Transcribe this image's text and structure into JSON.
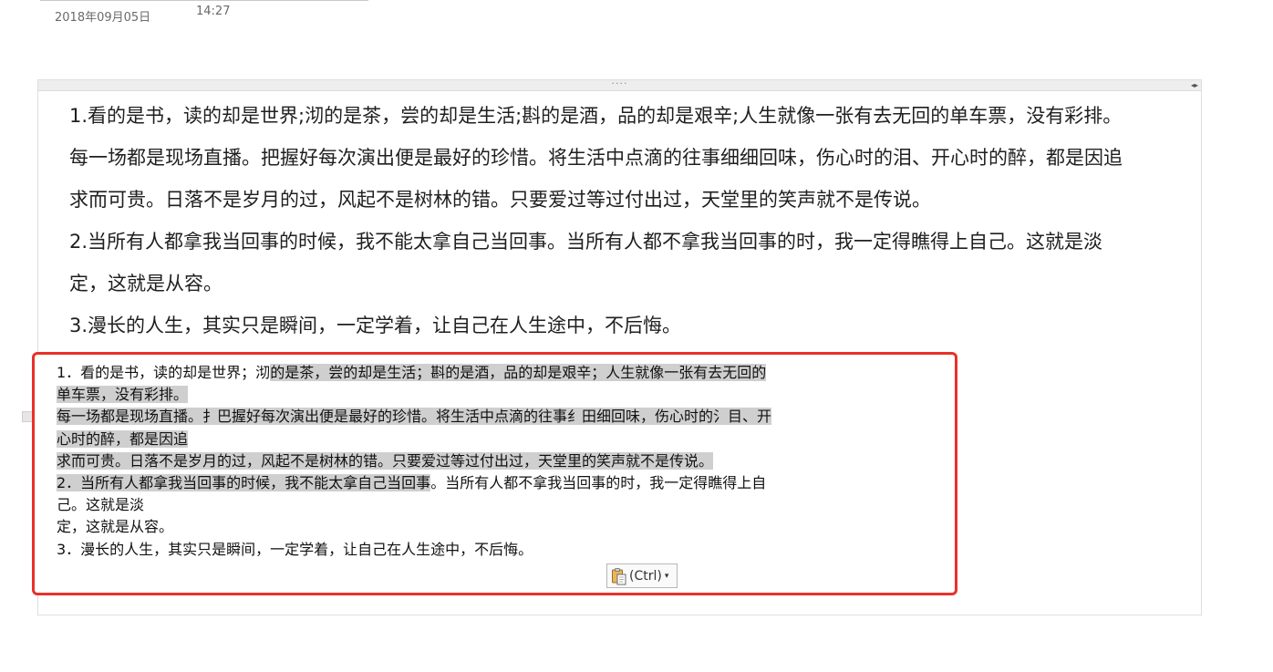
{
  "header": {
    "date": "2018年09月05日",
    "time": "14:27"
  },
  "container": {
    "drag_handle": "····",
    "resize_arrows": "◂▸"
  },
  "body_lines": [
    "1.看的是书，读的却是世界;沏的是茶，尝的却是生活;斟的是酒，品的却是艰辛;人生就像一张有去无回的单车票，没有彩排。",
    "每一场都是现场直播。把握好每次演出便是最好的珍惜。将生活中点滴的往事细细回味，伤心时的泪、开心时的醉，都是因追",
    "求而可贵。日落不是岁月的过，风起不是树林的错。只要爱过等过付出过，天堂里的笑声就不是传说。",
    "2.当所有人都拿我当回事的时候，我不能太拿自己当回事。当所有人都不拿我当回事的时，我一定得瞧得上自己。这就是淡",
    "定，这就是从容。",
    "3.漫长的人生，其实只是瞬间，一定学着，让自己在人生途中，不后悔。"
  ],
  "pasted": {
    "line1_plain": "1．看的是书，读的却是世界；沏",
    "line1_hl": "的是茶，尝的却是生活；斟的是酒，品的却是艰辛；人生就像一张有去无回的",
    "line2_hl": "单车票，没有彩排。",
    "line3_hl": "每一场都是现场直播。扌巴握好每次演出便是最好的珍惜。将生活中点滴的往事纟田细回味，伤心时的氵目、开",
    "line4_hl": "心时的醉，都是因追",
    "line5_hl": "求而可贵。日落不是岁月的过，风起不是树林的错。只要爱过等过付出过，天堂里的笑声就不是传说。",
    "line6_hl": "2．当所有人都拿我当回事的时候，我不能太拿自己当回事",
    "line6_plain": "。当所有人都不拿我当回事的时，我一定得瞧得上自",
    "line7": "己。这就是淡",
    "line8": "定，这就是从容。",
    "line9": "3．漫长的人生，其实只是瞬间，一定学着，让自己在人生途中，不后悔。"
  },
  "paste_options": {
    "label": "(Ctrl)",
    "icon": "clipboard-icon"
  },
  "colors": {
    "highlight_border": "#e8312a",
    "selection": "#cfcfcf"
  }
}
